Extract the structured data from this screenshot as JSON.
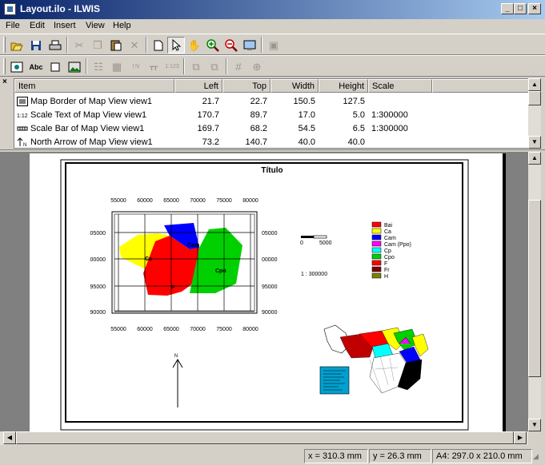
{
  "window": {
    "title": "Layout.ilo - ILWIS"
  },
  "menu": [
    {
      "label": "File",
      "key": "F"
    },
    {
      "label": "Edit",
      "key": "E"
    },
    {
      "label": "Insert",
      "key": "I"
    },
    {
      "label": "View",
      "key": "V"
    },
    {
      "label": "Help",
      "key": "H"
    }
  ],
  "toolbar2": {
    "text_button": "Abc",
    "north_button": "N",
    "scale_text_button": "1:123"
  },
  "item_list": {
    "columns": [
      "Item",
      "Left",
      "Top",
      "Width",
      "Height",
      "Scale"
    ],
    "rows": [
      {
        "icon": "map-border-icon",
        "item": "Map Border of Map View view1",
        "left": "21.7",
        "top": "22.7",
        "width": "150.5",
        "height": "127.5",
        "scale": ""
      },
      {
        "icon": "scale-text-icon",
        "item": "Scale Text of Map View view1",
        "left": "170.7",
        "top": "89.7",
        "width": "17.0",
        "height": "5.0",
        "scale": "1:300000"
      },
      {
        "icon": "scale-bar-icon",
        "item": "Scale Bar of Map View view1",
        "left": "169.7",
        "top": "68.2",
        "width": "54.5",
        "height": "6.5",
        "scale": "1:300000"
      },
      {
        "icon": "north-arrow-icon",
        "item": "North Arrow of Map View view1",
        "left": "73.2",
        "top": "140.7",
        "width": "40.0",
        "height": "40.0",
        "scale": ""
      }
    ]
  },
  "layout": {
    "title": "Título",
    "map_top_ticks": [
      "55000",
      "60000",
      "65000",
      "70000",
      "75000",
      "80000"
    ],
    "map_bottom_ticks": [
      "55000",
      "60000",
      "65000",
      "70000",
      "75000",
      "80000"
    ],
    "map_left_ticks": [
      "05000",
      "00000",
      "95000",
      "90000"
    ],
    "map_right_ticks": [
      "05000",
      "00000",
      "95000",
      "90000"
    ],
    "map_labels": [
      "Ca",
      "Cam",
      "Cpo",
      "F"
    ],
    "scale_bar": {
      "start": "0",
      "end": "5000"
    },
    "scale_text": "1 : 300000",
    "north_label": "N",
    "legend": [
      {
        "label": "Bai",
        "color": "#ff0000"
      },
      {
        "label": "Ca",
        "color": "#ffff00"
      },
      {
        "label": "Cam",
        "color": "#0000ff"
      },
      {
        "label": "Cam (Ppo)",
        "color": "#ff00ff"
      },
      {
        "label": "Cp",
        "color": "#00ffff"
      },
      {
        "label": "Cpo",
        "color": "#00d000"
      },
      {
        "label": "F",
        "color": "#ff0000"
      },
      {
        "label": "Fr",
        "color": "#800000"
      },
      {
        "label": "H",
        "color": "#808000"
      }
    ]
  },
  "status": {
    "x": "x = 310.3 mm",
    "y": "y = 26.3 mm",
    "paper": "A4:  297.0 x 210.0 mm"
  }
}
